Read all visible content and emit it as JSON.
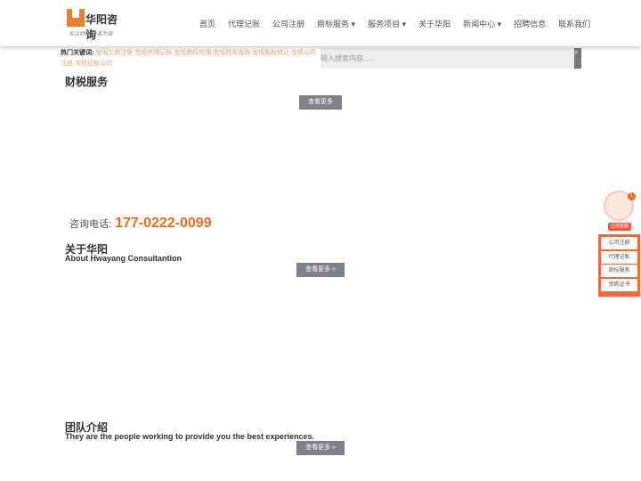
{
  "header": {
    "logo_name": "华阳咨询",
    "logo_slogan": "专注财税 以客为尊",
    "nav": [
      "首页",
      "代理记账",
      "公司注册",
      "商标服务 ▾",
      "服务项目 ▾",
      "关于华阳",
      "新闻中心 ▾",
      "招聘信息",
      "联系我们"
    ]
  },
  "hot": {
    "label": "热门关键词:",
    "keywords": "宝坻工商注册 宝坻代理记账 宝坻商标代理 宝坻财务咨询 宝坻股权转让 宝坻公司注册 宝坻记账公司"
  },
  "search": {
    "placeholder": "输入搜索内容......",
    "icon": "search-icon"
  },
  "sections": {
    "tax": {
      "title": "财税服务",
      "more": "查看更多"
    },
    "phone": {
      "label": "咨询电话:",
      "number": "177-0222-0099"
    },
    "about": {
      "title": "关于华阳",
      "subtitle": "About Hwayang Consultantion",
      "more": "查看更多 »"
    },
    "team": {
      "title": "团队介绍",
      "subtitle": "They are the people working to provide you the best experiences.",
      "more": "查看更多 »"
    }
  },
  "widget": {
    "badge": "1",
    "label": "在线客服",
    "items": [
      "公司注册",
      "代理记账",
      "商标服务",
      "资质证书"
    ],
    "accent": "#f06a3c"
  }
}
